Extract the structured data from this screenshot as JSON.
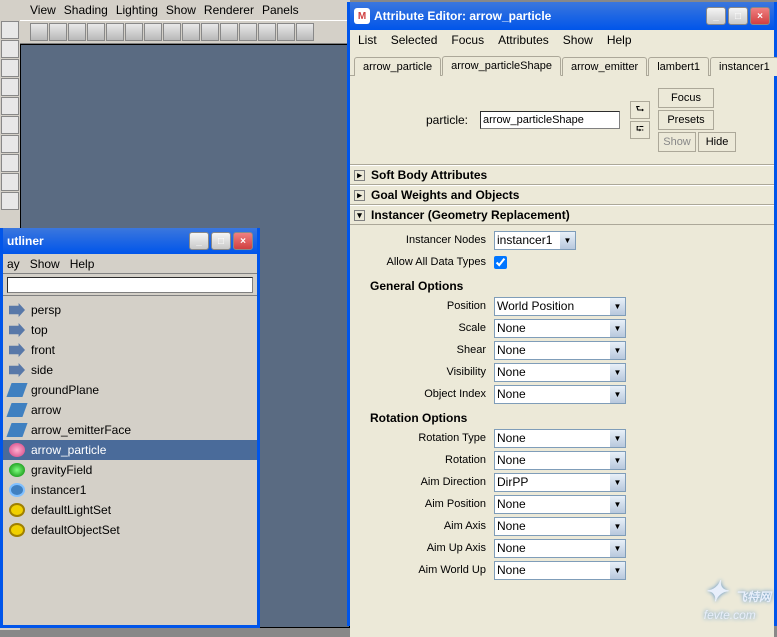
{
  "viewport": {
    "menus": [
      "View",
      "Shading",
      "Lighting",
      "Show",
      "Renderer",
      "Panels"
    ]
  },
  "outliner": {
    "title": "utliner",
    "menus": [
      "ay",
      "Show",
      "Help"
    ],
    "items": [
      {
        "icon": "cam-icon",
        "label": "persp"
      },
      {
        "icon": "cam-icon",
        "label": "top"
      },
      {
        "icon": "cam-icon",
        "label": "front"
      },
      {
        "icon": "cam-icon",
        "label": "side"
      },
      {
        "icon": "mesh-icon",
        "label": "groundPlane"
      },
      {
        "icon": "mesh-icon",
        "label": "arrow"
      },
      {
        "icon": "mesh-icon",
        "label": "arrow_emitterFace"
      },
      {
        "icon": "particle-icon",
        "label": "arrow_particle",
        "selected": true
      },
      {
        "icon": "field-icon",
        "label": "gravityField"
      },
      {
        "icon": "inst-icon",
        "label": "instancer1"
      },
      {
        "icon": "set-icon",
        "label": "defaultLightSet"
      },
      {
        "icon": "set-icon",
        "label": "defaultObjectSet"
      }
    ]
  },
  "attrEditor": {
    "title": "Attribute Editor: arrow_particle",
    "menus": [
      "List",
      "Selected",
      "Focus",
      "Attributes",
      "Show",
      "Help"
    ],
    "tabs": [
      "arrow_particle",
      "arrow_particleShape",
      "arrow_emitter",
      "lambert1",
      "instancer1"
    ],
    "activeTab": 1,
    "header": {
      "label": "particle:",
      "value": "arrow_particleShape",
      "buttons": {
        "focus": "Focus",
        "presets": "Presets",
        "show": "Show",
        "hide": "Hide"
      }
    },
    "sections": {
      "softBody": "Soft Body Attributes",
      "goal": "Goal Weights and Objects",
      "instancer": {
        "title": "Instancer (Geometry Replacement)",
        "instancerNodes": {
          "label": "Instancer Nodes",
          "value": "instancer1"
        },
        "allowAll": {
          "label": "Allow All Data Types",
          "checked": true
        },
        "general": {
          "title": "General Options",
          "rows": [
            {
              "label": "Position",
              "value": "World Position"
            },
            {
              "label": "Scale",
              "value": "None"
            },
            {
              "label": "Shear",
              "value": "None"
            },
            {
              "label": "Visibility",
              "value": "None"
            },
            {
              "label": "Object Index",
              "value": "None"
            }
          ]
        },
        "rotation": {
          "title": "Rotation Options",
          "rows": [
            {
              "label": "Rotation Type",
              "value": "None"
            },
            {
              "label": "Rotation",
              "value": "None"
            },
            {
              "label": "Aim Direction",
              "value": "DirPP"
            },
            {
              "label": "Aim Position",
              "value": "None"
            },
            {
              "label": "Aim Axis",
              "value": "None"
            },
            {
              "label": "Aim Up Axis",
              "value": "None"
            },
            {
              "label": "Aim World Up",
              "value": "None"
            }
          ]
        }
      }
    }
  },
  "watermark": {
    "text": "飞特网",
    "url": "fevte.com"
  }
}
